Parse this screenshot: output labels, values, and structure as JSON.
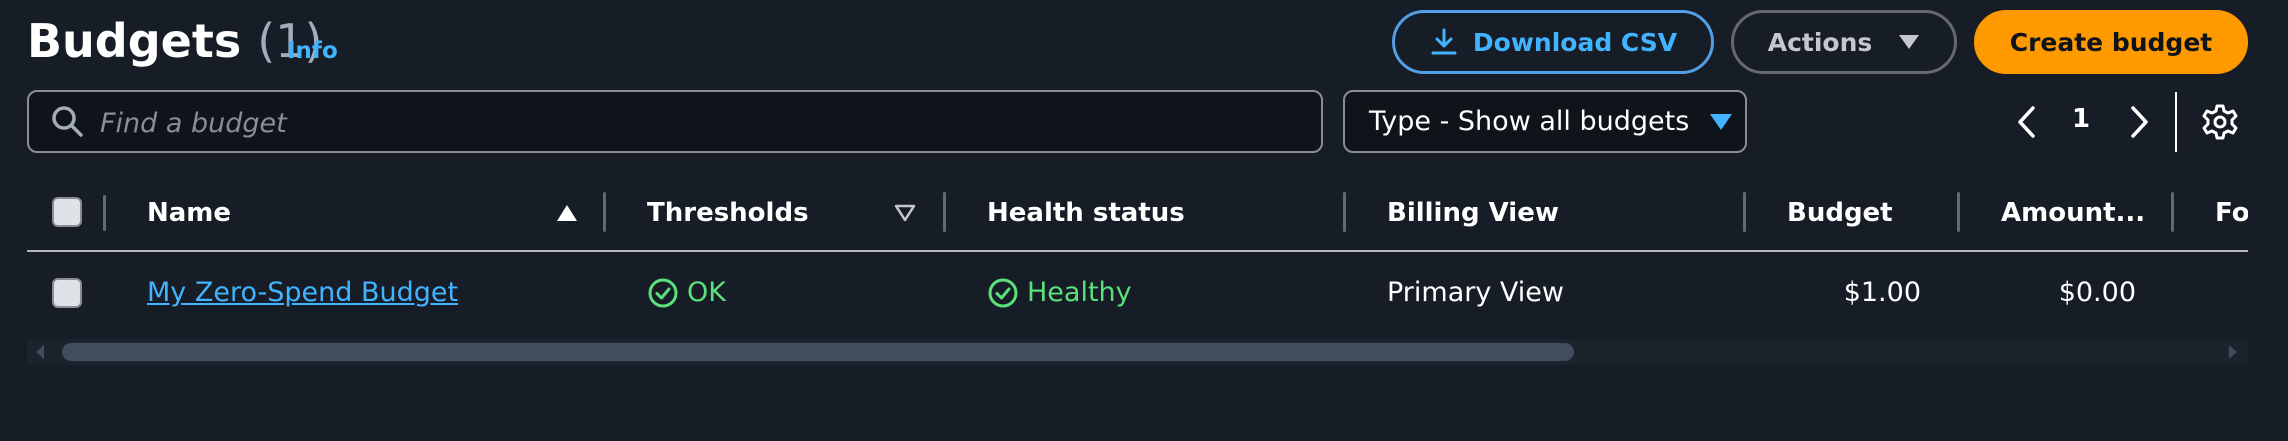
{
  "page": {
    "title": "Budgets",
    "count": "(1)",
    "info_link": "Info"
  },
  "toolbar": {
    "download_label": "Download CSV",
    "actions_label": "Actions",
    "create_label": "Create budget"
  },
  "search": {
    "placeholder": "Find a budget",
    "value": ""
  },
  "filter": {
    "label": "Type - Show all budgets"
  },
  "pagination": {
    "current_page": "1"
  },
  "table": {
    "columns": [
      "Name",
      "Thresholds",
      "Health status",
      "Billing View",
      "Budget",
      "Amount...",
      "Fo"
    ],
    "rows": [
      {
        "name": "My Zero-Spend Budget",
        "thresholds": "OK",
        "health_status": "Healthy",
        "billing_view": "Primary View",
        "budget": "$1.00",
        "amount": "$0.00"
      }
    ]
  },
  "colors": {
    "background": "#161d26",
    "link": "#42b4ff",
    "primary_button": "#ff9900",
    "success": "#5ce07c"
  }
}
